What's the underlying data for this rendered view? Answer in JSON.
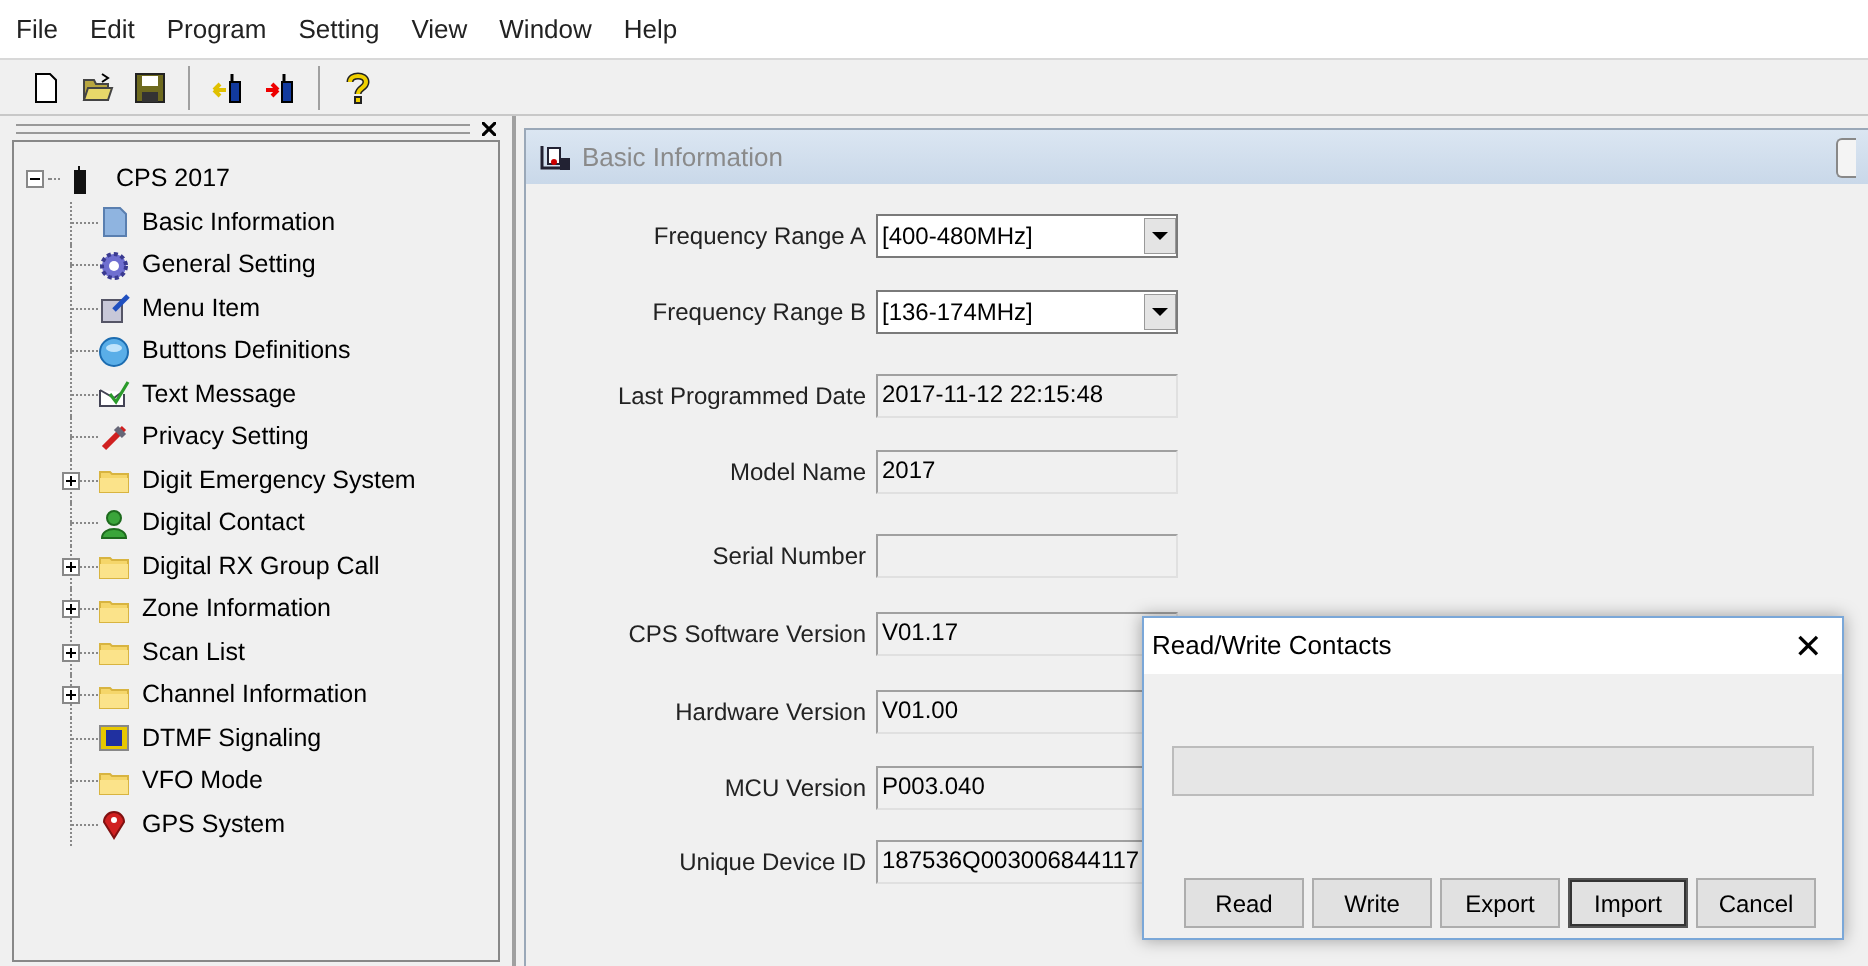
{
  "menu_bar": [
    "File",
    "Edit",
    "Program",
    "Setting",
    "View",
    "Window",
    "Help"
  ],
  "tree": {
    "label": "CPS 2017",
    "expanded": true,
    "children": [
      {
        "label": "Basic Information",
        "collapsed": false
      },
      {
        "label": "General Setting",
        "collapsed": false
      },
      {
        "label": "Menu Item",
        "collapsed": false
      },
      {
        "label": "Buttons Definitions",
        "collapsed": false
      },
      {
        "label": "Text Message",
        "collapsed": false
      },
      {
        "label": "Privacy Setting",
        "collapsed": false
      },
      {
        "label": "Digit Emergency System",
        "collapsed": true
      },
      {
        "label": "Digital Contact",
        "collapsed": false
      },
      {
        "label": "Digital RX Group Call",
        "collapsed": true
      },
      {
        "label": "Zone Information",
        "collapsed": true
      },
      {
        "label": "Scan List",
        "collapsed": true
      },
      {
        "label": "Channel Information",
        "collapsed": true
      },
      {
        "label": "DTMF Signaling",
        "collapsed": false
      },
      {
        "label": "VFO Mode",
        "collapsed": false
      },
      {
        "label": "GPS System",
        "collapsed": false
      }
    ]
  },
  "panel": {
    "title": "Basic Information",
    "fields": [
      {
        "label": "Frequency Range A",
        "kind": "dropdown",
        "value": "[400-480MHz]"
      },
      {
        "label": "Frequency Range B",
        "kind": "dropdown",
        "value": "[136-174MHz]"
      },
      {
        "label": "Last Programmed Date",
        "kind": "readonly",
        "value": "2017-11-12 22:15:48"
      },
      {
        "label": "Model Name",
        "kind": "readonly",
        "value": "2017"
      },
      {
        "label": "Serial Number",
        "kind": "readonly"
      },
      {
        "label": "CPS Software Version",
        "kind": "readonly",
        "value": "V01.17"
      },
      {
        "label": "Hardware Version",
        "kind": "readonly",
        "value": "V01.00"
      },
      {
        "label": "MCU Version",
        "kind": "readonly",
        "value": "P003.040"
      },
      {
        "label": "Unique Device ID",
        "kind": "readonly",
        "value": "187536Q003006844117"
      }
    ]
  },
  "dialog": {
    "title": "Read/Write Contacts",
    "close": "✕",
    "progress": {
      "level": 0
    },
    "buttons": [
      {
        "label": "Read",
        "selected": false
      },
      {
        "label": "Write",
        "selected": false
      },
      {
        "label": "Export",
        "selected": false
      },
      {
        "label": "Import",
        "selected": true
      },
      {
        "label": "Cancel",
        "selected": false
      }
    ]
  }
}
